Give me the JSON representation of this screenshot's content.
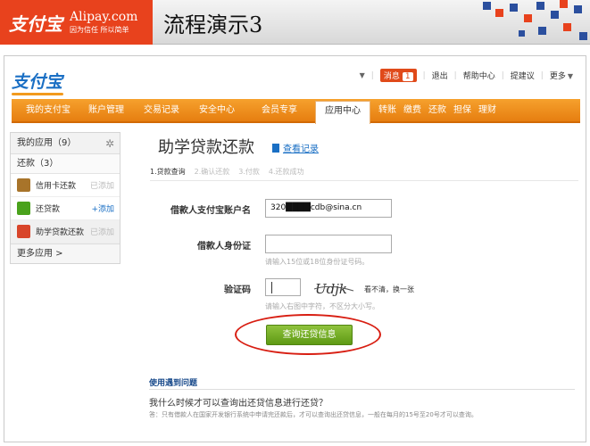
{
  "banner": {
    "logo_text": "支付宝",
    "domain": "Alipay.com",
    "tagline": "因为信任 所以简单",
    "slide_title": "流程演示3"
  },
  "topbar": {
    "logo": "支付宝",
    "message_label": "消息",
    "message_count": "1",
    "logout": "退出",
    "help": "帮助中心",
    "suggest": "提建议",
    "more": "更多"
  },
  "nav": {
    "items": [
      "我的支付宝",
      "账户管理",
      "交易记录",
      "安全中心",
      "会员专享",
      "应用中心"
    ],
    "active_index": 5,
    "extras": [
      "转账",
      "缴费",
      "还款",
      "担保",
      "理财"
    ]
  },
  "sidebar": {
    "my_apps": "我的应用（9）",
    "section": "还款（3）",
    "items": [
      {
        "label": "信用卡还款",
        "status": "已添加",
        "color": "#a8742a"
      },
      {
        "label": "还贷款",
        "status": "+添加",
        "color": "#4aa21c"
      },
      {
        "label": "助学贷款还款",
        "status": "已添加",
        "color": "#d8452a"
      }
    ],
    "more": "更多应用 >"
  },
  "main": {
    "title": "助学贷款还款",
    "record_link": "查看记录",
    "steps": [
      "1.贷款查询",
      "2.确认还款",
      "3.付款",
      "4.还款成功"
    ],
    "account_label": "借款人支付宝账户名",
    "account_value": "320████cdb@sina.cn",
    "id_label": "借款人身份证",
    "id_hint": "请输入15位或18位身份证号码。",
    "captcha_label": "验证码",
    "captcha_text": "Udjk",
    "captcha_refresh": "看不清，换一张",
    "captcha_hint": "请输入右图中字符，不区分大小写。",
    "submit": "查询还贷信息"
  },
  "help": {
    "title": "使用遇到问题",
    "question": "我什么时候才可以查询出还贷信息进行还贷？",
    "answer": "答：只有借款人在国家开发银行系统中申请完还款后，才可以查询出还贷信息，一般在每月的15号至20号才可以查询。"
  }
}
